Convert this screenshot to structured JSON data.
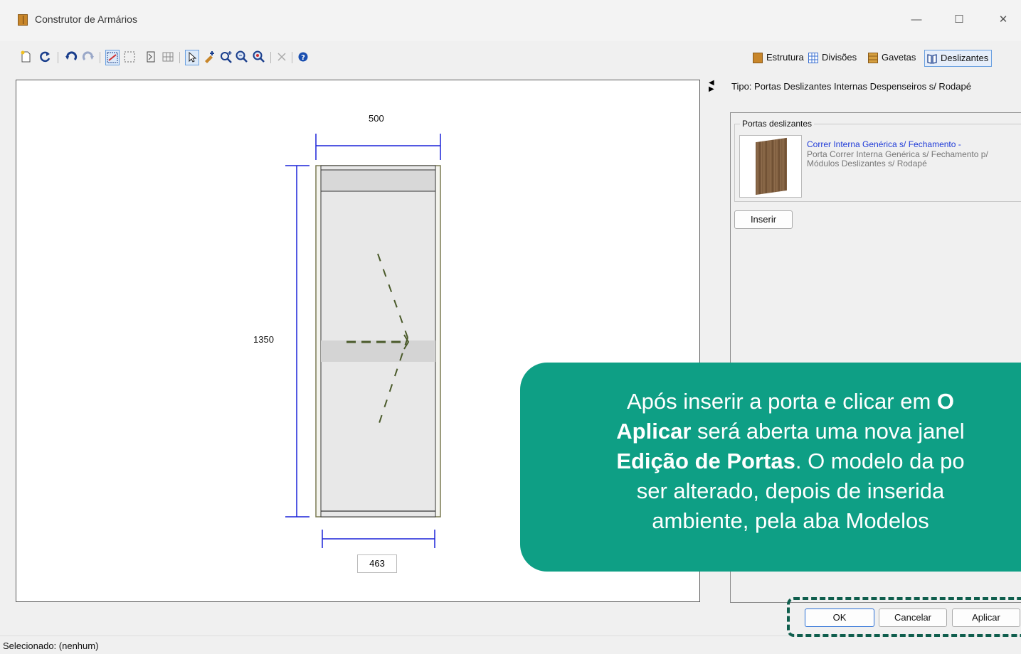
{
  "window": {
    "title": "Construtor de Armários",
    "controls": [
      "—",
      "☐",
      "✕"
    ]
  },
  "toolbar": {
    "icons": [
      "new-icon",
      "reset-icon",
      "undo-icon",
      "redo-icon",
      "draw-select-icon",
      "marquee-icon",
      "divide-icon",
      "grid-icon",
      "pointer-icon",
      "add-item-icon",
      "zoom-in-icon",
      "zoom-fit-icon",
      "zoom-out-icon",
      "delete-icon",
      "help-icon"
    ]
  },
  "tabs": [
    {
      "label": "Estrutura",
      "color": "#c8862a"
    },
    {
      "label": "Divisões",
      "color": "#3a6fd0"
    },
    {
      "label": "Gavetas",
      "color": "#c8862a"
    },
    {
      "label": "Deslizantes",
      "color": "#1a3e8c",
      "active": true
    }
  ],
  "drawing": {
    "width_label": "500",
    "height_label": "1350",
    "inner_width_label": "463",
    "colors": {
      "dimension": "#1a22d8",
      "frame": "#8a8a5a",
      "panel": "#e6e6e6",
      "arrow": "#4a5a2a"
    }
  },
  "side_panel": {
    "tipo": "Tipo: Portas Deslizantes Internas Despenseiros s/ Rodapé",
    "group_label": "Portas deslizantes",
    "item": {
      "title": "Correr Interna Genérica s/ Fechamento -",
      "description": "Porta Correr Interna Genérica s/ Fechamento p/ Módulos Deslizantes s/ Rodapé"
    },
    "insert_label": "Inserir"
  },
  "footer": {
    "ok_label": "OK",
    "cancel_label": "Cancelar",
    "apply_label": "Aplicar",
    "status": "Selecionado: (nenhum)"
  },
  "callout": {
    "line1_pre": "Após inserir a porta e clicar em ",
    "line1_bold": "O",
    "line2_bold": "Aplicar",
    "line2_rest": " será aberta uma nova janel",
    "line3_bold": "Edição de Portas",
    "line3_rest": ". O modelo da po",
    "line4": "ser alterado, depois de inserida",
    "line5": "ambiente, pela aba Modelos",
    "color": "#0e9f85"
  }
}
